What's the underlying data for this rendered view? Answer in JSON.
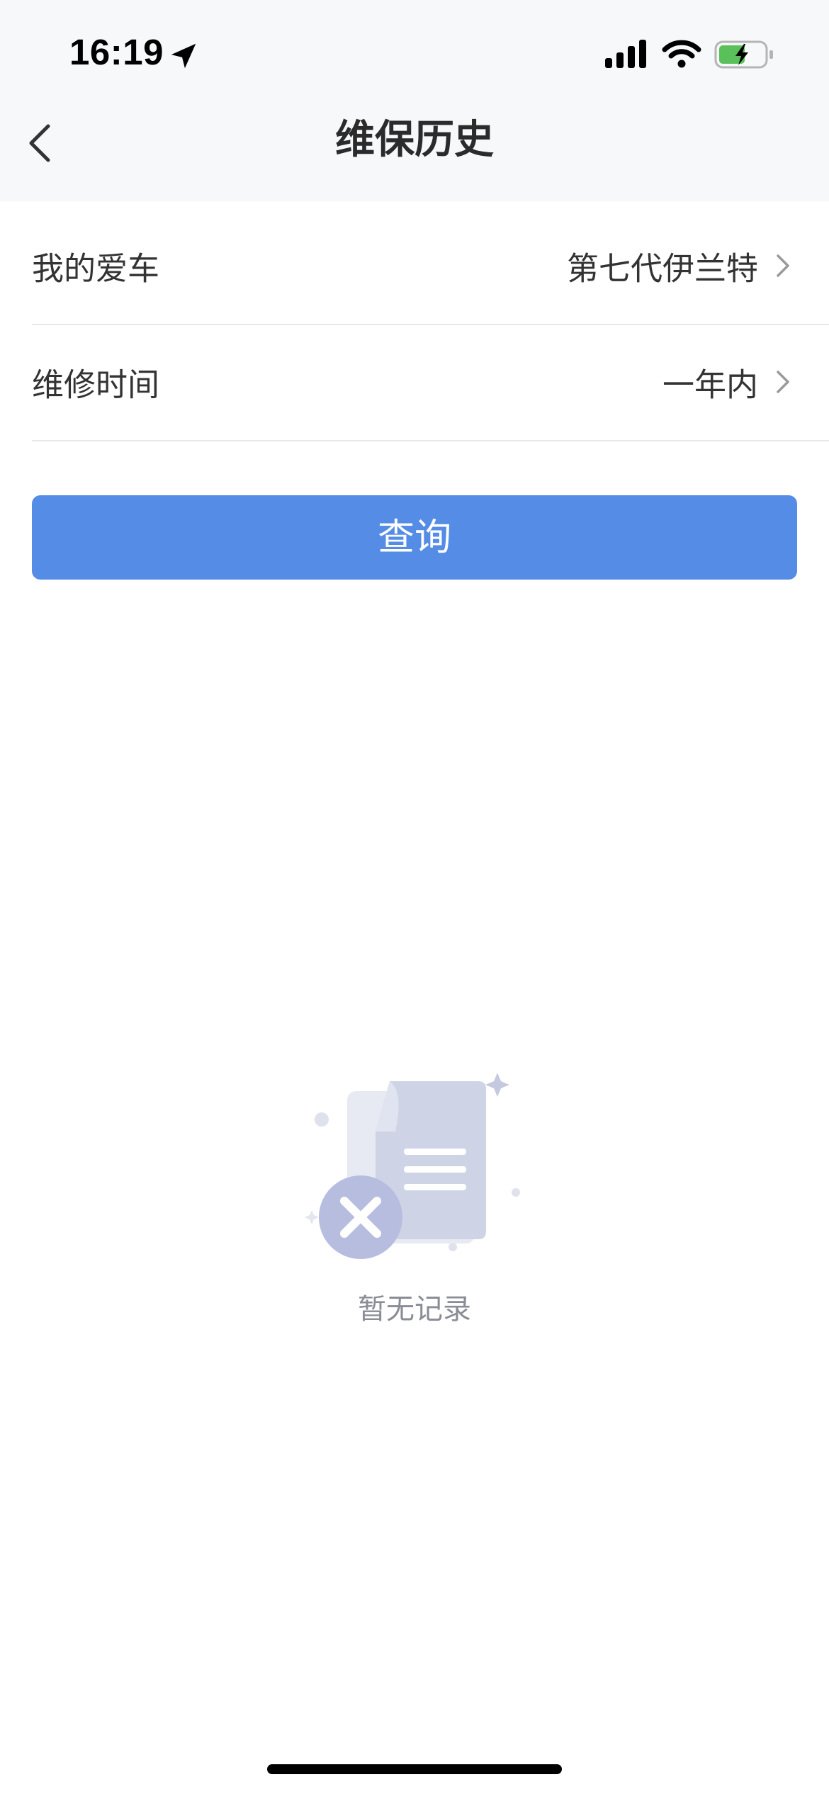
{
  "status_bar": {
    "time": "16:19",
    "location_icon": "location-arrow-icon",
    "signal_icon": "cellular-signal-icon",
    "wifi_icon": "wifi-icon",
    "battery_icon": "battery-charging-icon"
  },
  "nav": {
    "title": "维保历史",
    "back_icon": "chevron-left-icon"
  },
  "form": {
    "car": {
      "label": "我的爱车",
      "value": "第七代伊兰特"
    },
    "time": {
      "label": "维修时间",
      "value": "一年内"
    }
  },
  "query_button": {
    "label": "查询",
    "color": "#558ce5"
  },
  "empty_state": {
    "icon": "empty-document-icon",
    "text": "暂无记录"
  }
}
